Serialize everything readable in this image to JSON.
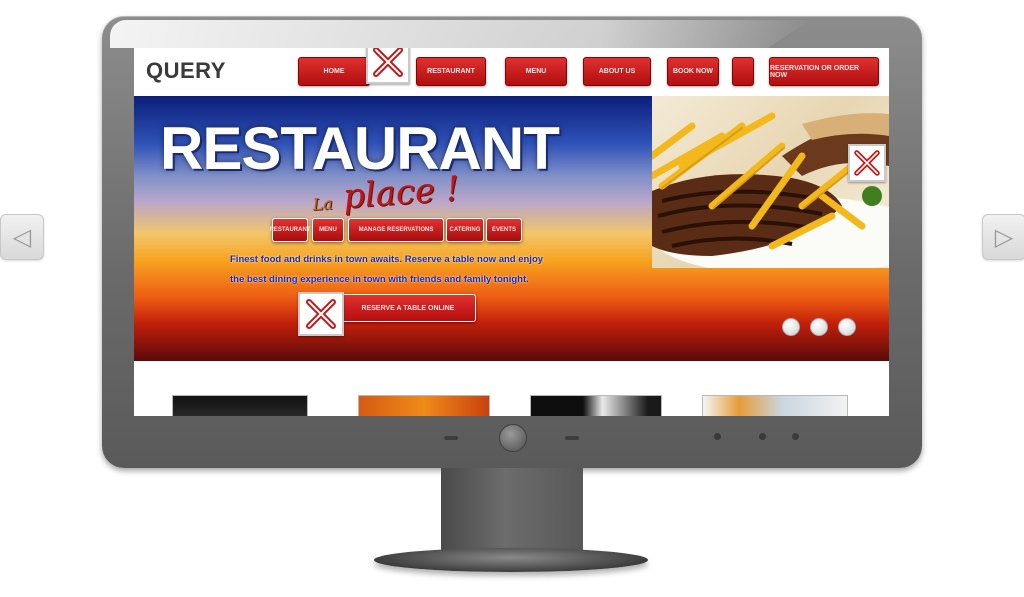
{
  "site": {
    "logo": "QUERY",
    "nav": [
      {
        "label": "HOME"
      },
      {
        "label": "RESTAURANT"
      },
      {
        "label": "MENU"
      },
      {
        "label": "ABOUT US"
      },
      {
        "label": "BOOK NOW"
      },
      {
        "label": ""
      },
      {
        "label": "RESERVATION OR ORDER NOW"
      }
    ]
  },
  "hero": {
    "title": "RESTAURANT",
    "script_small": "La",
    "script": "place !",
    "buttons": [
      {
        "label": "RESTAURANT"
      },
      {
        "label": "MENU"
      },
      {
        "label": "MANAGE RESERVATIONS"
      },
      {
        "label": "CATERING"
      },
      {
        "label": "EVENTS"
      }
    ],
    "text_line1": "Finest food and drinks in town awaits. Reserve a table now and enjoy",
    "text_line2": "the best dining experience in town with friends and family tonight.",
    "cta_label": "RESERVE A TABLE ONLINE"
  },
  "colors": {
    "nav_red": "#c41818",
    "bezel": "#6b6b6b"
  },
  "icons": {
    "left_arrow": "◁",
    "right_arrow": "▷"
  }
}
